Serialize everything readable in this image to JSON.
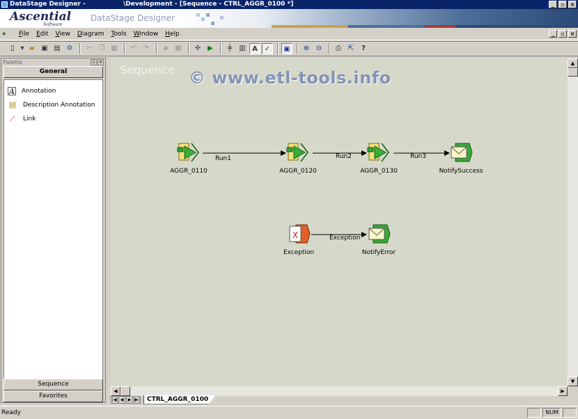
{
  "window": {
    "title_left": "DataStage Designer -",
    "title_right": "\\Development - [Sequence - CTRL_AGGR_0100 *]"
  },
  "banner": {
    "logo": "Ascential",
    "logo_sub": "Software",
    "product": "DataStage Designer"
  },
  "menu": {
    "items": [
      "File",
      "Edit",
      "View",
      "Diagram",
      "Tools",
      "Window",
      "Help"
    ]
  },
  "palette": {
    "title": "Palette",
    "header_tab": "General",
    "items": [
      {
        "label": "Annotation",
        "icon": "annotation-icon"
      },
      {
        "label": "Description Annotation",
        "icon": "description-annotation-icon"
      },
      {
        "label": "Link",
        "icon": "link-icon"
      }
    ],
    "bottom_tabs": [
      "Sequence",
      "Favorites"
    ]
  },
  "canvas": {
    "title": "Sequence",
    "watermark": "© www.etl-tools.info",
    "stages": [
      {
        "id": "aggr_0110",
        "label": "AGGR_0110",
        "type": "job-activity"
      },
      {
        "id": "aggr_0120",
        "label": "AGGR_0120",
        "type": "job-activity"
      },
      {
        "id": "aggr_0130",
        "label": "AGGR_0130",
        "type": "job-activity"
      },
      {
        "id": "notifysuccess",
        "label": "NotifySuccess",
        "type": "notification"
      },
      {
        "id": "exception",
        "label": "Exception",
        "type": "exception-handler"
      },
      {
        "id": "notifyerror",
        "label": "NotifyError",
        "type": "notification"
      }
    ],
    "links": [
      {
        "from": "aggr_0110",
        "to": "aggr_0120",
        "label": "Run1"
      },
      {
        "from": "aggr_0120",
        "to": "aggr_0130",
        "label": "Run2"
      },
      {
        "from": "aggr_0130",
        "to": "notifysuccess",
        "label": "Run3"
      },
      {
        "from": "exception",
        "to": "notifyerror",
        "label": "Exception"
      }
    ],
    "sheet_tab": "CTRL_AGGR_0100",
    "background_color": "#d6d9c9"
  },
  "statusbar": {
    "message": "Ready",
    "num": "NUM"
  },
  "colors": {
    "titlebar": "#0a246a",
    "chrome": "#d4d0c8"
  }
}
